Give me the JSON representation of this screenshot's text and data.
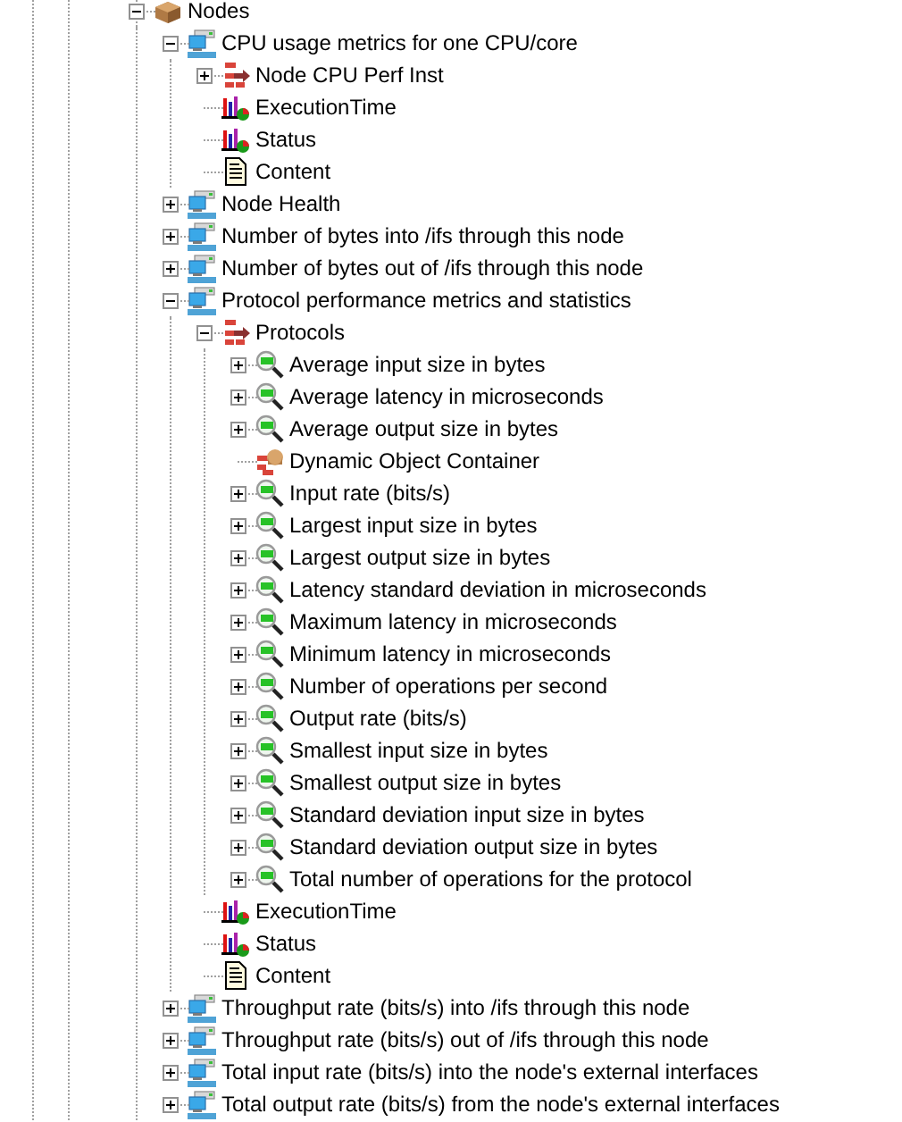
{
  "tree": [
    {
      "label": "Nodes",
      "kind": "package",
      "expanded": true,
      "children": [
        {
          "label": "CPU usage metrics for one CPU/core",
          "kind": "snmp",
          "expanded": true,
          "children": [
            {
              "label": "Node CPU Perf Inst",
              "kind": "class",
              "expanded": false
            },
            {
              "label": "ExecutionTime",
              "kind": "chart"
            },
            {
              "label": "Status",
              "kind": "chart"
            },
            {
              "label": "Content",
              "kind": "document"
            }
          ]
        },
        {
          "label": "Node Health",
          "kind": "snmp",
          "expanded": false
        },
        {
          "label": "Number of bytes into /ifs through this node",
          "kind": "snmp",
          "expanded": false
        },
        {
          "label": "Number of bytes out of /ifs through this node",
          "kind": "snmp",
          "expanded": false
        },
        {
          "label": "Protocol performance metrics and statistics",
          "kind": "snmp",
          "expanded": true,
          "children": [
            {
              "label": "Protocols",
              "kind": "class",
              "expanded": true,
              "children": [
                {
                  "label": "Average input size in bytes",
                  "kind": "counter",
                  "expanded": false
                },
                {
                  "label": "Average latency in microseconds",
                  "kind": "counter",
                  "expanded": false
                },
                {
                  "label": "Average output size in bytes",
                  "kind": "counter",
                  "expanded": false
                },
                {
                  "label": "Dynamic Object Container",
                  "kind": "container"
                },
                {
                  "label": "Input rate (bits/s)",
                  "kind": "counter",
                  "expanded": false
                },
                {
                  "label": "Largest input size in bytes",
                  "kind": "counter",
                  "expanded": false
                },
                {
                  "label": "Largest output size in bytes",
                  "kind": "counter",
                  "expanded": false
                },
                {
                  "label": "Latency standard deviation in microseconds",
                  "kind": "counter",
                  "expanded": false
                },
                {
                  "label": "Maximum latency in microseconds",
                  "kind": "counter",
                  "expanded": false
                },
                {
                  "label": "Minimum latency in microseconds",
                  "kind": "counter",
                  "expanded": false
                },
                {
                  "label": "Number of operations per second",
                  "kind": "counter",
                  "expanded": false
                },
                {
                  "label": "Output rate (bits/s)",
                  "kind": "counter",
                  "expanded": false
                },
                {
                  "label": "Smallest input size in bytes",
                  "kind": "counter",
                  "expanded": false
                },
                {
                  "label": "Smallest output size in bytes",
                  "kind": "counter",
                  "expanded": false
                },
                {
                  "label": "Standard deviation input size in bytes",
                  "kind": "counter",
                  "expanded": false
                },
                {
                  "label": "Standard deviation output size in bytes",
                  "kind": "counter",
                  "expanded": false
                },
                {
                  "label": "Total number of operations for the protocol",
                  "kind": "counter",
                  "expanded": false
                }
              ]
            },
            {
              "label": "ExecutionTime",
              "kind": "chart"
            },
            {
              "label": "Status",
              "kind": "chart"
            },
            {
              "label": "Content",
              "kind": "document"
            }
          ]
        },
        {
          "label": "Throughput rate (bits/s) into /ifs through this node",
          "kind": "snmp",
          "expanded": false
        },
        {
          "label": "Throughput rate (bits/s) out of /ifs through this node",
          "kind": "snmp",
          "expanded": false
        },
        {
          "label": "Total input rate (bits/s) into the node's external interfaces",
          "kind": "snmp",
          "expanded": false
        },
        {
          "label": "Total output rate (bits/s) from the node's external interfaces",
          "kind": "snmp",
          "expanded": false
        }
      ]
    }
  ]
}
